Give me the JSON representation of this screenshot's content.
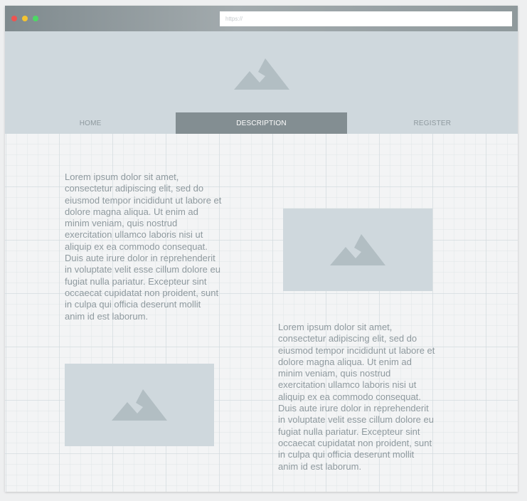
{
  "browser": {
    "url_placeholder": "https://",
    "window_controls": [
      "close-dot",
      "minimize-dot",
      "maximize-dot"
    ]
  },
  "hero": {
    "icon": "mountain-image-placeholder-icon"
  },
  "nav": {
    "tabs": [
      {
        "label": "HOME",
        "active": false
      },
      {
        "label": "DESCRIPTION",
        "active": true
      },
      {
        "label": "REGISTER",
        "active": false
      }
    ]
  },
  "content": {
    "left_text": "Lorem ipsum dolor sit amet, consectetur adipiscing elit, sed do eiusmod tempor incididunt ut labore et dolore magna aliqua. Ut enim ad minim veniam, quis nostrud exercitation ullamco laboris nisi ut aliquip ex ea commodo consequat. Duis aute irure dolor in reprehenderit in voluptate velit esse cillum dolore eu fugiat nulla pariatur. Excepteur sint occaecat cupidatat non proident, sunt in culpa qui officia deserunt mollit anim id est laborum.",
    "right_text": "Lorem ipsum dolor sit amet, consectetur adipiscing elit, sed do eiusmod tempor incididunt ut labore et dolore magna aliqua. Ut enim ad minim veniam, quis nostrud exercitation ullamco laboris nisi ut aliquip ex ea commodo consequat. Duis aute irure dolor in reprehenderit in voluptate velit esse cillum dolore eu fugiat nulla pariatur. Excepteur sint occaecat cupidatat non proident, sunt in culpa qui officia deserunt mollit anim id est laborum."
  },
  "colors": {
    "placeholder_bg": "#cfd8dd",
    "placeholder_icon": "#b2bec3",
    "active_tab": "#838e92",
    "text": "#8e999e",
    "close": "#ef5350",
    "minimize": "#f4c430",
    "maximize": "#4cd964"
  }
}
